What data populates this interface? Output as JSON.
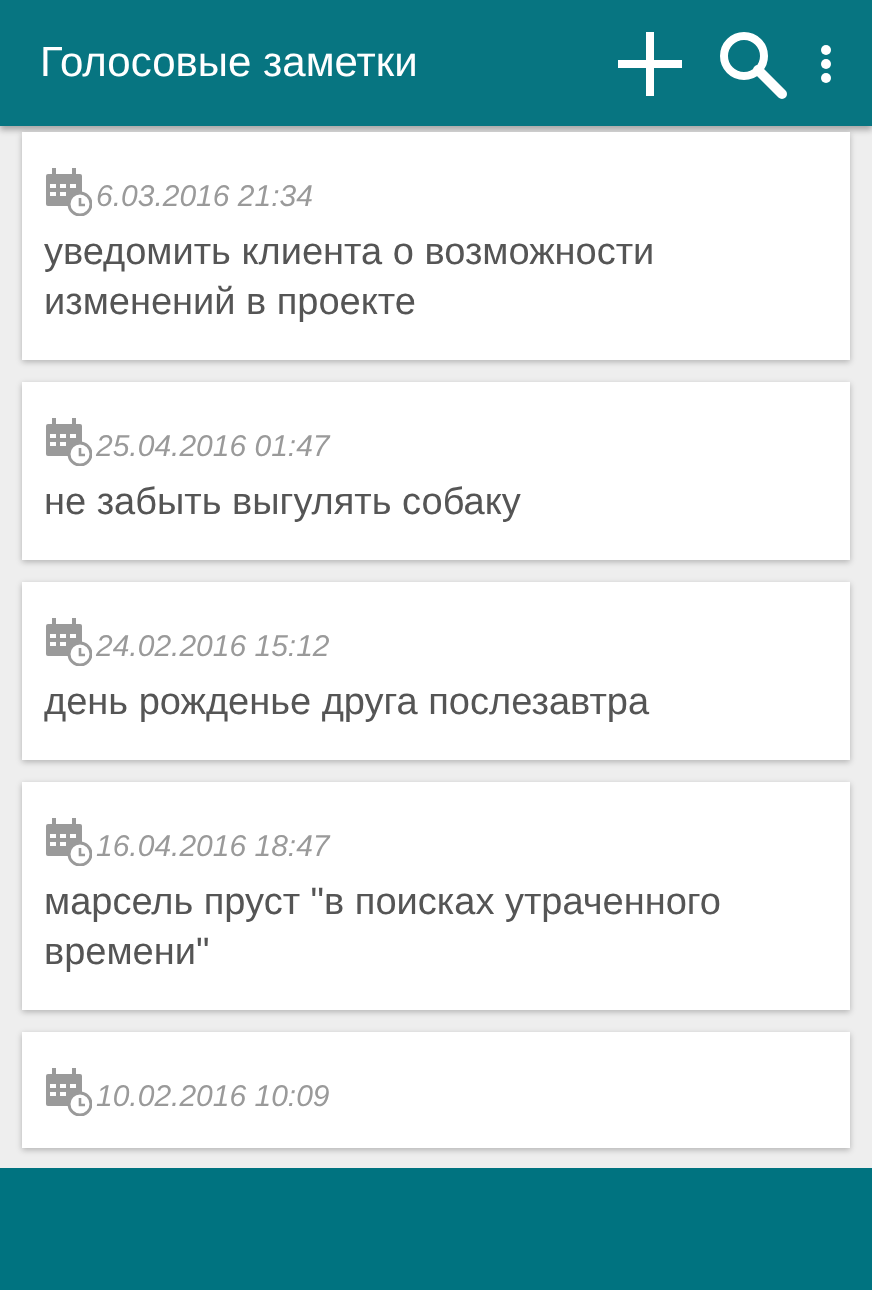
{
  "app_bar": {
    "title": "Голосовые заметки"
  },
  "notes": [
    {
      "date": "6.03.2016 21:34",
      "text": "уведомить клиента о возможности изменений в проекте"
    },
    {
      "date": "25.04.2016 01:47",
      "text": "не забыть выгулять собаку"
    },
    {
      "date": "24.02.2016 15:12",
      "text": "день рожденье друга послезавтра"
    },
    {
      "date": "16.04.2016 18:47",
      "text": "марсель пруст \"в поисках утраченного времени\""
    },
    {
      "date": "10.02.2016 10:09"
    }
  ]
}
